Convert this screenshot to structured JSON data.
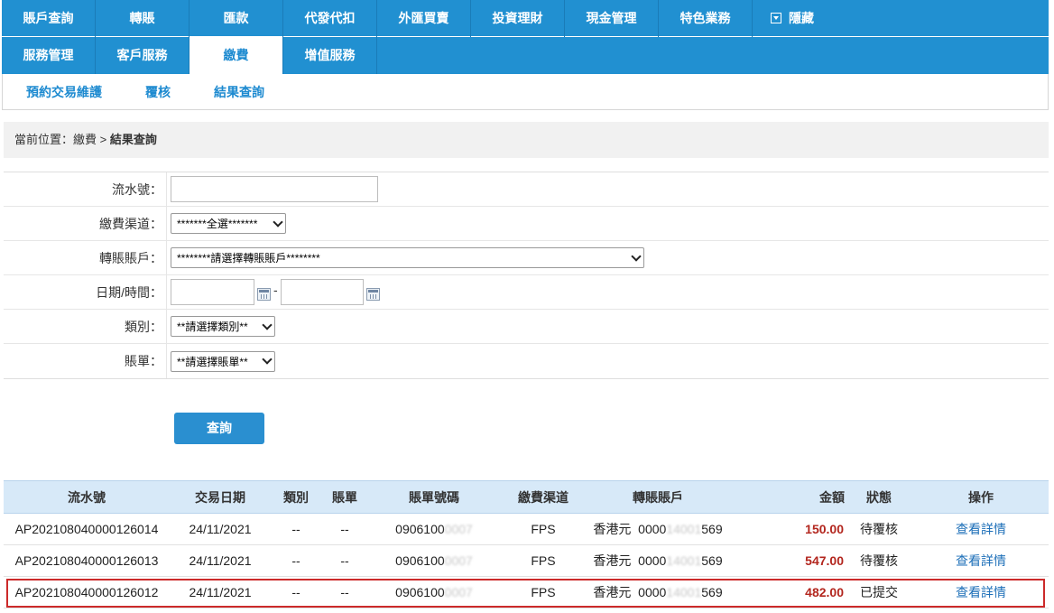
{
  "nav": {
    "row1": [
      "賬戶查詢",
      "轉賬",
      "匯款",
      "代發代扣",
      "外匯買賣",
      "投資理財",
      "現金管理",
      "特色業務"
    ],
    "hide_label": "隱藏",
    "row2": [
      "服務管理",
      "客戶服務",
      "繳費",
      "增值服務"
    ],
    "active": "繳費"
  },
  "subnav": [
    "預約交易維護",
    "覆核",
    "結果查詢"
  ],
  "breadcrumb": {
    "prefix": "當前位置：繳費 > ",
    "current": "結果查詢"
  },
  "form": {
    "serial_label": "流水號：",
    "serial_value": "",
    "channel_label": "繳費渠道：",
    "channel_value": "*******全選*******",
    "account_label": "轉賬賬戶：",
    "account_value": "********請選擇轉賬賬戶********",
    "date_label": "日期/時間：",
    "date_from": "",
    "date_to": "",
    "date_separator": "-",
    "category_label": "類別：",
    "category_value": "**請選擇類別**",
    "bill_label": "賬單：",
    "bill_value": "**請選擇賬單**"
  },
  "query_button": "查詢",
  "table": {
    "headers": [
      "流水號",
      "交易日期",
      "類別",
      "賬單",
      "賬單號碼",
      "繳費渠道",
      "轉賬賬戶",
      "金額",
      "狀態",
      "操作"
    ],
    "rows": [
      {
        "serial": "AP202108040000126014",
        "date": "24/11/2021",
        "category": "--",
        "bill": "--",
        "bill_no_prefix": "0906100",
        "bill_no_masked": "0007",
        "channel": "FPS",
        "acct_ccy": "香港元",
        "acct_prefix": "0000",
        "acct_masked": "14001",
        "acct_suffix": "569",
        "amount": "150.00",
        "status": "待覆核",
        "action": "查看詳情"
      },
      {
        "serial": "AP202108040000126013",
        "date": "24/11/2021",
        "category": "--",
        "bill": "--",
        "bill_no_prefix": "0906100",
        "bill_no_masked": "0007",
        "channel": "FPS",
        "acct_ccy": "香港元",
        "acct_prefix": "0000",
        "acct_masked": "14001",
        "acct_suffix": "569",
        "amount": "547.00",
        "status": "待覆核",
        "action": "查看詳情"
      },
      {
        "serial": "AP202108040000126012",
        "date": "24/11/2021",
        "category": "--",
        "bill": "--",
        "bill_no_prefix": "0906100",
        "bill_no_masked": "0007",
        "channel": "FPS",
        "acct_ccy": "香港元",
        "acct_prefix": "0000",
        "acct_masked": "14001",
        "acct_suffix": "569",
        "amount": "482.00",
        "status": "已提交",
        "action": "查看詳情"
      }
    ]
  },
  "colors": {
    "nav_bg": "#2190d1",
    "accent": "#1d8ad0",
    "amount": "#b3261e",
    "highlight": "#cc2a2a"
  }
}
